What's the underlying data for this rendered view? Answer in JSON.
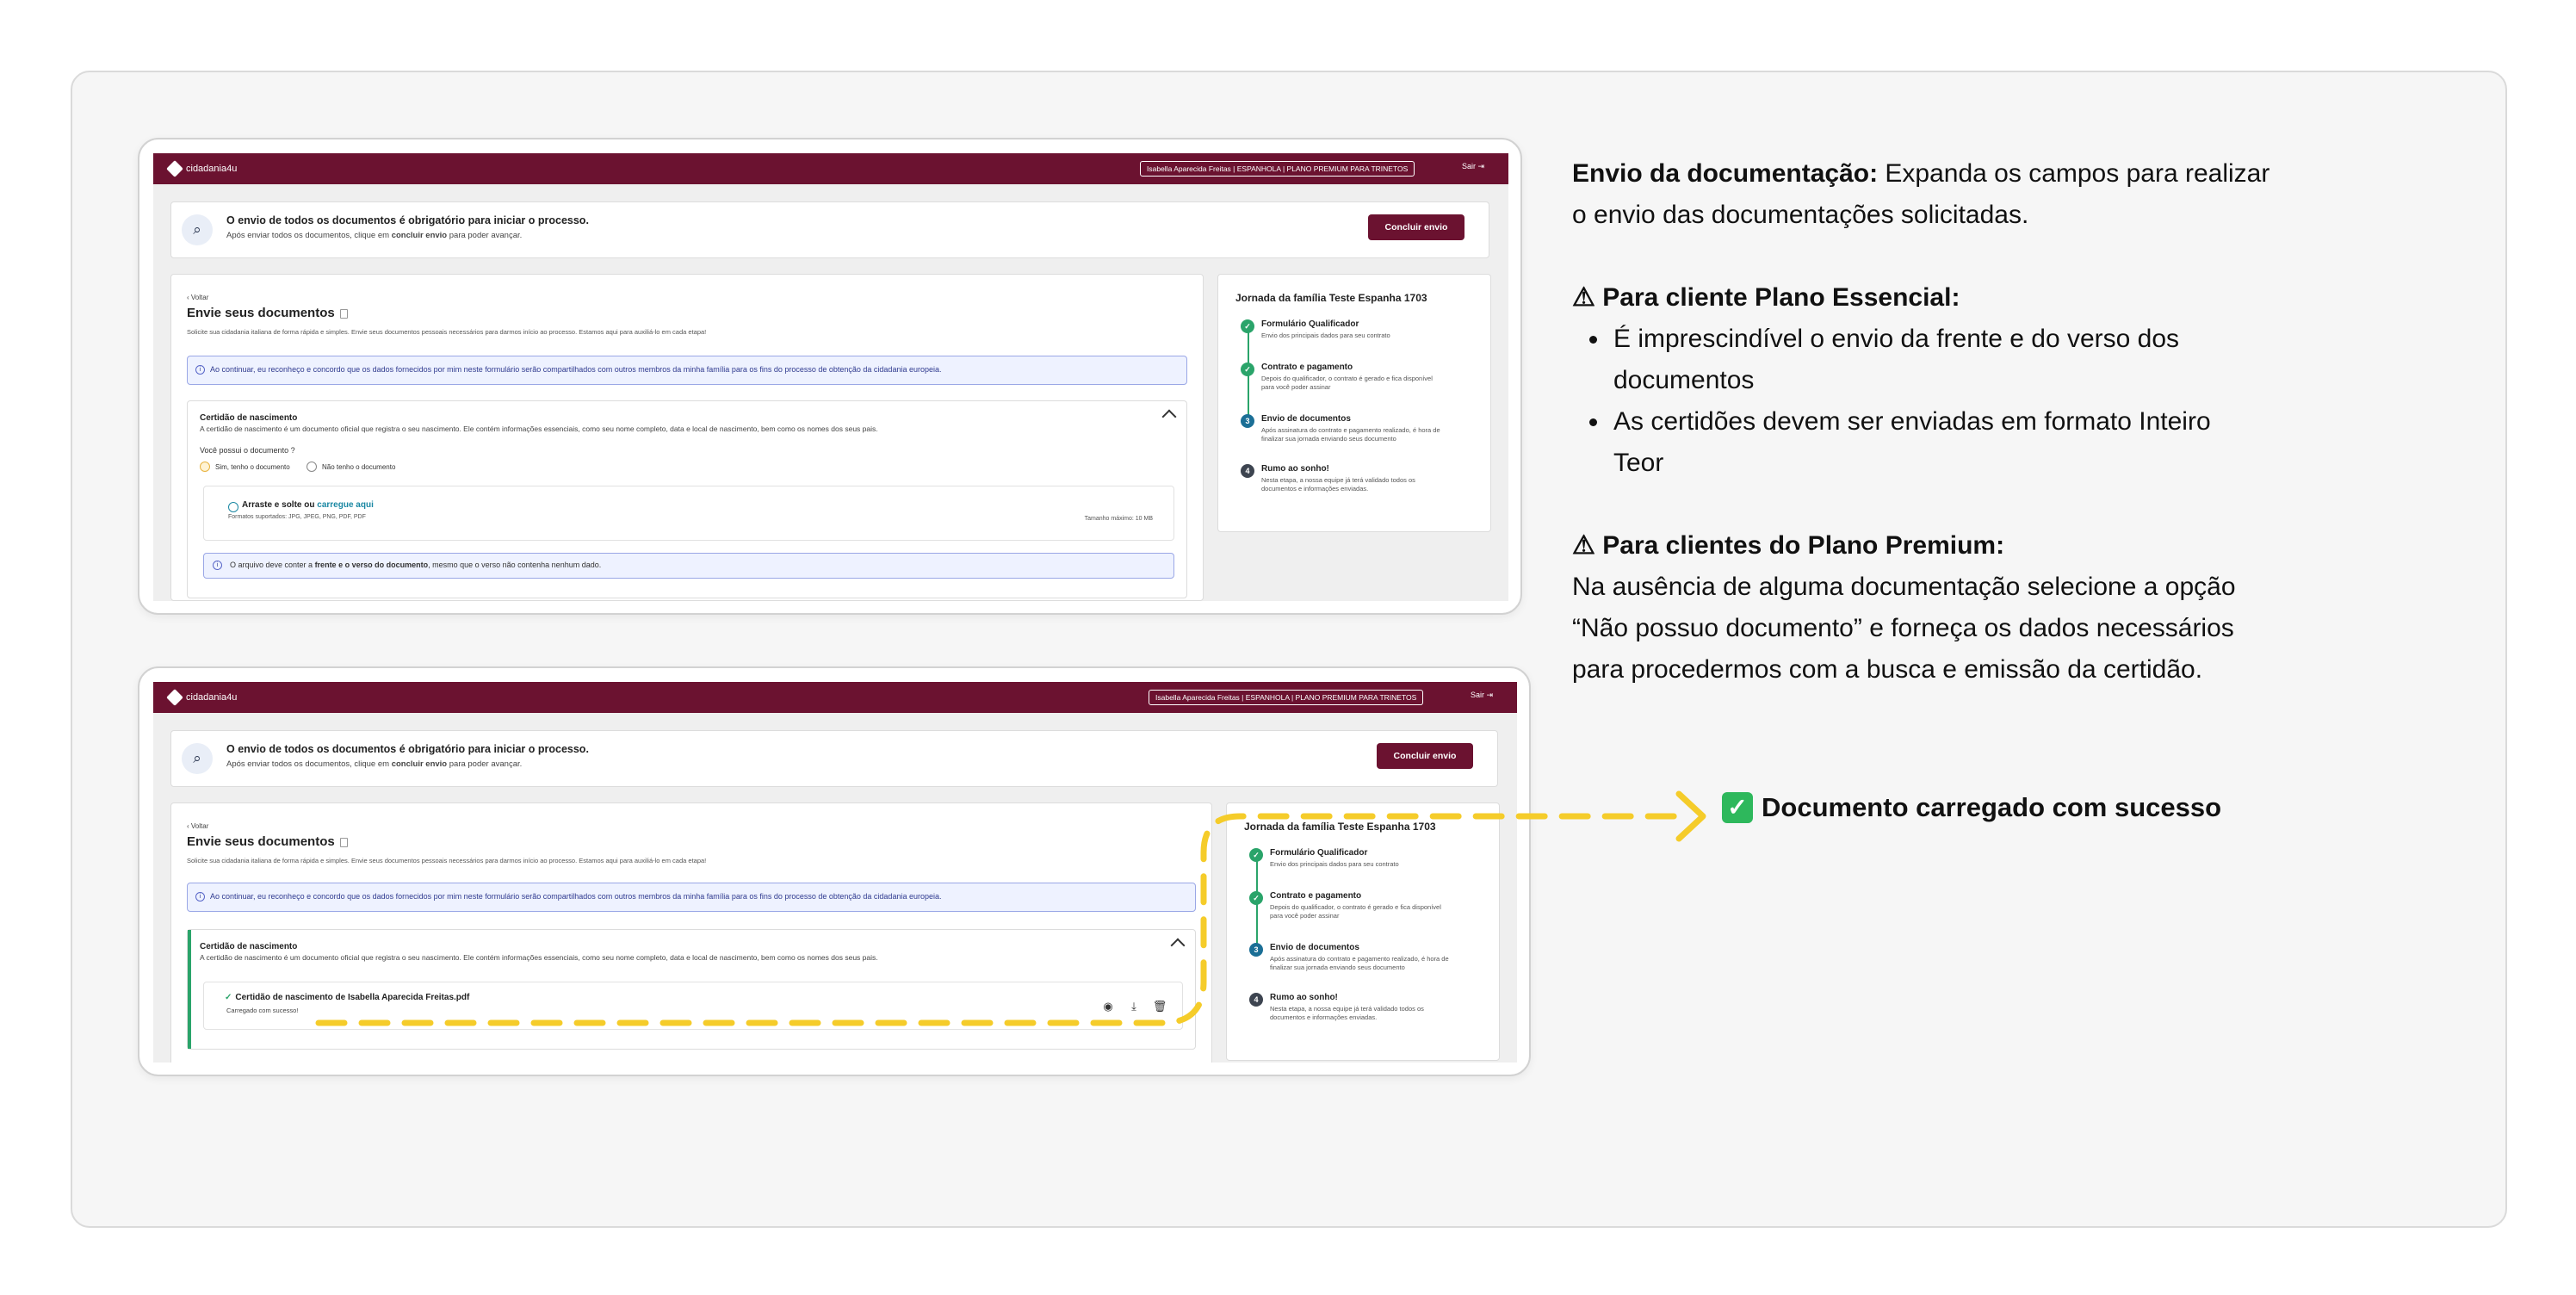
{
  "app": {
    "logo_text": "cidadania4u",
    "user_pill": "Isabella Aparecida Freitas  |  ESPANHOLA  |  PLANO PREMIUM PARA TRINETOS",
    "logout_label": "Sair",
    "notice_title": "O envio de todos os documentos é obrigatório para iniciar o processo.",
    "notice_sub_a": "Após enviar todos os documentos, clique em ",
    "notice_sub_b": "concluir envio",
    "notice_sub_c": " para poder avançar.",
    "concluir_label": "Concluir envio",
    "voltar_label": "Voltar",
    "page_title": "Envie seus documentos",
    "page_sub": "Solicite sua cidadania italiana de forma rápida e simples. Envie seus documentos pessoais necessários para darmos início ao processo. Estamos aqui para auxiliá-lo em cada etapa!",
    "consent": "Ao continuar, eu reconheço e concordo que os dados fornecidos por mim neste formulário serão compartilhados com outros membros da minha família para os fins do processo de obtenção da cidadania europeia.",
    "card_title": "Certidão de nascimento",
    "card_desc": "A certidão de nascimento é um documento oficial que registra o seu nascimento. Ele contém informações essenciais, como seu nome completo, data e local de nascimento, bem como os nomes dos seus pais.",
    "question": "Você possui o documento ?",
    "radio_yes": "Sim, tenho o documento",
    "radio_no": "Não tenho o documento",
    "upload_a": "Arraste e solte ou ",
    "upload_link": "carregue aqui",
    "upload_formats": "Formatos suportados: JPG, JPEG, PNG, PDF, PDF",
    "upload_size": "Tamanho máximo: 10 MB",
    "note_a": "O arquivo deve conter a ",
    "note_b": "frente e o verso do documento",
    "note_c": ", mesmo que o verso não contenha nenhum dado.",
    "file_name": "Certidão de nascimento de Isabella Aparecida Freitas.pdf",
    "file_ok": "Carregado com sucesso!",
    "journey_title": "Jornada da família Teste Espanha 1703",
    "steps": [
      {
        "num": "✓",
        "title": "Formulário Qualificador",
        "desc": "Envio dos principais dados para seu contrato"
      },
      {
        "num": "✓",
        "title": "Contrato e pagamento",
        "desc": "Depois do qualificador, o contrato é gerado e fica disponível\npara você poder assinar"
      },
      {
        "num": "3",
        "title": "Envio de documentos",
        "desc": "Após assinatura do contrato e pagamento realizado, é hora de\nfinalizar sua jornada enviando seus documento"
      },
      {
        "num": "4",
        "title": "Rumo ao sonho!",
        "desc": "Nesta etapa, a nossa equipe já terá validado todos os\ndocumentos e informações enviadas."
      }
    ]
  },
  "annotations": {
    "p1_bold": "Envio da documentação:",
    "p1_line1": " Expanda os campos para realizar",
    "p1_line2": "o envio das documentações solicitadas.",
    "warn_icon": "⚠",
    "essencial_title": "Para cliente Plano Essencial:",
    "essencial_items": [
      "É imprescindível o envio da frente e do verso dos",
      "documentos",
      "As certidões devem ser enviadas em formato Inteiro",
      "Teor"
    ],
    "premium_title": "Para clientes do Plano Premium:",
    "premium_lines": [
      "Na ausência de alguma documentação selecione a opção",
      "“Não possuo documento” e forneça os dados necessários",
      "para procedermos com a busca e emissão da certidão."
    ],
    "success_icon": "✓",
    "success_text": "Documento carregado com sucesso"
  },
  "colors": {
    "brand": "#6b1230",
    "success": "#2aa46a",
    "highlight": "#f5cc2a"
  }
}
